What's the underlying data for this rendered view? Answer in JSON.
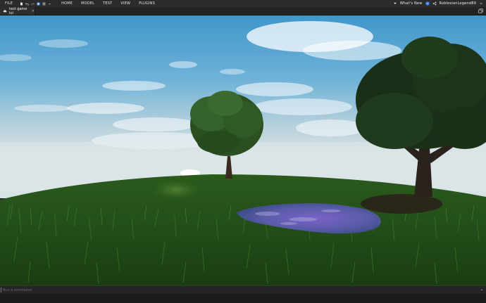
{
  "menubar": {
    "file": "FILE",
    "items": [
      {
        "label": "HOME"
      },
      {
        "label": "MODEL"
      },
      {
        "label": "TEST"
      },
      {
        "label": "VIEW"
      },
      {
        "label": "PLUGINS"
      }
    ],
    "toolbar_icons": [
      "new-file-icon",
      "undo-icon",
      "redo-icon",
      "publish-icon",
      "play-icon",
      "dropdown-icon"
    ],
    "whats_new": "What's New",
    "username": "RobloxianLegend89"
  },
  "tabs": [
    {
      "label": "test game lol",
      "icon": "cloud-icon"
    }
  ],
  "command_bar": {
    "placeholder": "Run a command"
  },
  "colors": {
    "menubar_bg": "#2b2b2b",
    "tab_bg": "#2e2e2e",
    "sky_top": "#3f97c9",
    "grass": "#2f5a1e"
  }
}
